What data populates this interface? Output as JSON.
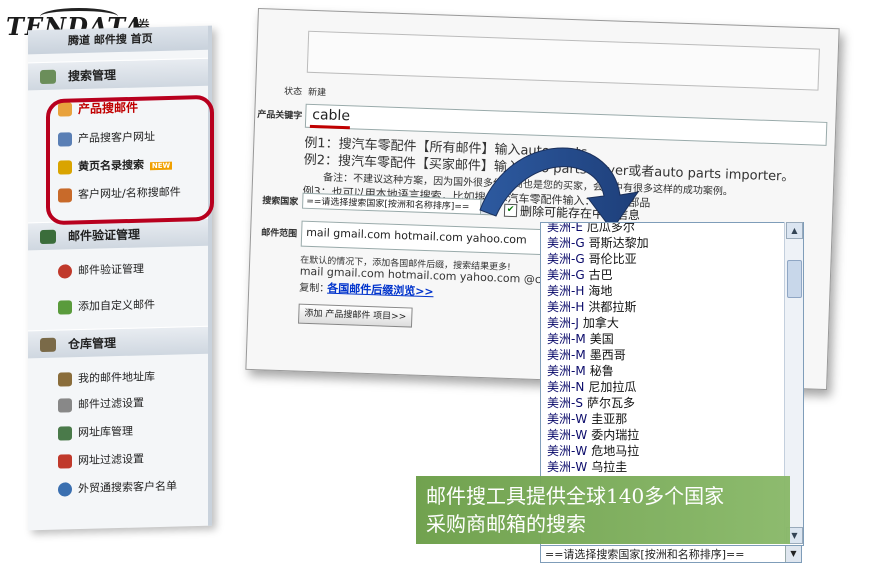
{
  "logo": {
    "en": "TENDATA",
    "cn": "腾道"
  },
  "sidebar": {
    "top_title": "腾道 邮件搜 首页",
    "sections": [
      {
        "label": "搜索管理",
        "icon": "search-globe-icon"
      },
      {
        "label": "邮件验证管理",
        "icon": "arrow-right-icon"
      },
      {
        "label": "仓库管理",
        "icon": "warehouse-icon"
      }
    ],
    "items": [
      {
        "label": "产品搜邮件",
        "icon": "search-icon",
        "highlight": true
      },
      {
        "label": "产品搜客户网址",
        "icon": "magnifier-icon"
      },
      {
        "label": "黄页名录搜索",
        "icon": "yellow-pages-icon",
        "badge": "NEW"
      },
      {
        "label": "客户网址/名称搜邮件",
        "icon": "exchange-icon"
      },
      {
        "label": "邮件验证管理",
        "icon": "ribbon-icon"
      },
      {
        "label": "添加自定义邮件",
        "icon": "mail-add-icon"
      },
      {
        "label": "我的邮件地址库",
        "icon": "address-book-icon"
      },
      {
        "label": "邮件过滤设置",
        "icon": "filter-icon"
      },
      {
        "label": "网址库管理",
        "icon": "checklist-icon"
      },
      {
        "label": "网址过滤设置",
        "icon": "block-icon"
      },
      {
        "label": "外贸通搜索客户名单",
        "icon": "users-icon"
      }
    ]
  },
  "main": {
    "status_label": "状态",
    "status_value": "新建",
    "keyword_label": "产品关键字",
    "keyword_value": "cable",
    "tips": [
      "例1：搜汽车零配件【所有邮件】输入auto parts。",
      "例2：搜汽车零配件【买家邮件】输入auto parts buyer或者auto parts importer。",
      "备注：不建议这种方案，因为国外很多供应商也是您的买家，会员中有很多这样的成功案例。",
      "例3：也可以用本地语言搜索，比如搜日本汽车零配件输入：自動車部品"
    ],
    "country_label": "搜索国家",
    "country_select": "==请选择搜索国家[按洲和名称排序]==",
    "remove_label": "删除可能存在中国信息",
    "email_scope_label": "邮件范围",
    "email_scope_value": "mail gmail.com hotmail.com yahoo.com",
    "note_line1": "在默认的情况下，添加各国邮件后缀，搜索结果更多!",
    "note_line2": "mail gmail.com hotmail.com yahoo.com @cwgsy",
    "copy_label": "复制：",
    "link_label": "各国邮件后缀浏览>>",
    "add_button": "添加 产品搜邮件 项目>>"
  },
  "dropdown": {
    "items": [
      {
        "region": "美洲-E",
        "country": "厄瓜多尔"
      },
      {
        "region": "美洲-G",
        "country": "哥斯达黎加"
      },
      {
        "region": "美洲-G",
        "country": "哥伦比亚"
      },
      {
        "region": "美洲-G",
        "country": "古巴"
      },
      {
        "region": "美洲-H",
        "country": "海地"
      },
      {
        "region": "美洲-H",
        "country": "洪都拉斯"
      },
      {
        "region": "美洲-J",
        "country": "加拿大"
      },
      {
        "region": "美洲-M",
        "country": "美国"
      },
      {
        "region": "美洲-M",
        "country": "墨西哥"
      },
      {
        "region": "美洲-M",
        "country": "秘鲁"
      },
      {
        "region": "美洲-N",
        "country": "尼加拉瓜"
      },
      {
        "region": "美洲-S",
        "country": "萨尔瓦多"
      },
      {
        "region": "美洲-W",
        "country": "圭亚那"
      },
      {
        "region": "美洲-W",
        "country": "委内瑞拉"
      },
      {
        "region": "美洲-W",
        "country": "危地马拉"
      },
      {
        "region": "美洲-W",
        "country": "乌拉圭"
      }
    ],
    "selected": "==请选择搜索国家[按洲和名称排序]=="
  },
  "banner": {
    "line1": "邮件搜工具提供全球140多个国家",
    "line2": "采购商邮箱的搜索"
  },
  "colors": {
    "highlight_red": "#b8001e",
    "banner_green": "#7aad58",
    "link_blue": "#0033cc"
  }
}
